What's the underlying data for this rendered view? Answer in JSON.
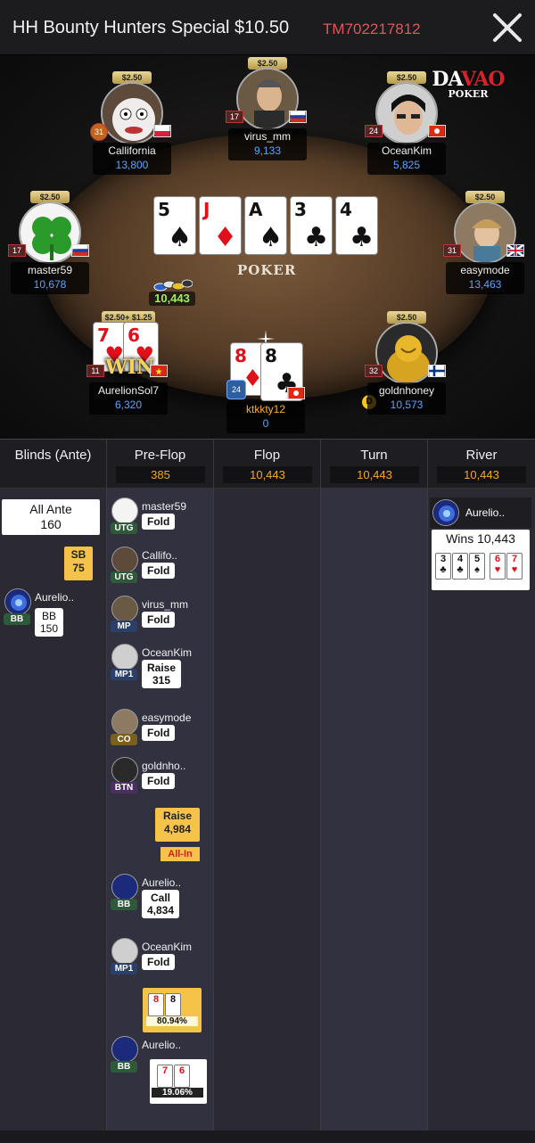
{
  "header": {
    "title": "HH Bounty Hunters Special $10.50",
    "hand_id": "TM702217812",
    "close_icon": "close-icon"
  },
  "logo": {
    "line1_a": "DA",
    "line1_b": "VAO",
    "line2": "POKER"
  },
  "table": {
    "watermark": "POKER",
    "pot": "10,443",
    "board": [
      {
        "rank": "5",
        "suit": "♠",
        "color": "black"
      },
      {
        "rank": "J",
        "suit": "♦",
        "color": "red"
      },
      {
        "rank": "A",
        "suit": "♠",
        "color": "black"
      },
      {
        "rank": "3",
        "suit": "♣",
        "color": "black"
      },
      {
        "rank": "4",
        "suit": "♣",
        "color": "black"
      }
    ],
    "seats": {
      "callifornia": {
        "name": "Callifornia",
        "stack": "13,800",
        "bet": "$2.50",
        "level": "31"
      },
      "virus": {
        "name": "virus_mm",
        "stack": "9,133",
        "bet": "$2.50",
        "level": "17"
      },
      "oceankim": {
        "name": "OceanKim",
        "stack": "5,825",
        "bet": "$2.50",
        "level": "24"
      },
      "master": {
        "name": "master59",
        "stack": "10,678",
        "bet": "$2.50",
        "level": "17"
      },
      "easymode": {
        "name": "easymode",
        "stack": "13,463",
        "bet": "$2.50",
        "level": "31"
      },
      "aurelion": {
        "name": "AurelionSol7",
        "stack": "6,320",
        "bet": "$2.50+ $1.25",
        "level": "11",
        "win": "WIN",
        "cards": [
          {
            "rank": "7",
            "suit": "♥"
          },
          {
            "rank": "6",
            "suit": "♥"
          }
        ]
      },
      "hero": {
        "name": "ktkkty12",
        "stack": "0",
        "level": "24",
        "cards": [
          {
            "rank": "8",
            "suit": "♦"
          },
          {
            "rank": "8",
            "suit": "♣"
          }
        ]
      },
      "goldnhoney": {
        "name": "goldnhoney",
        "stack": "10,573",
        "bet": "$2.50",
        "level": "32",
        "dealer": "D"
      }
    }
  },
  "streets": [
    {
      "name": "Blinds (Ante)",
      "amount": ""
    },
    {
      "name": "Pre-Flop",
      "amount": "385"
    },
    {
      "name": "Flop",
      "amount": "10,443"
    },
    {
      "name": "Turn",
      "amount": "10,443"
    },
    {
      "name": "River",
      "amount": "10,443"
    }
  ],
  "blinds": {
    "ante_label": "All Ante",
    "ante_value": "160",
    "sb_label": "SB",
    "sb_value": "75",
    "bb_player": "Aurelio..",
    "bb_pos": "BB",
    "bb_label": "BB",
    "bb_value": "150"
  },
  "preflop": [
    {
      "name": "master59",
      "pos": "UTG",
      "action": "Fold"
    },
    {
      "name": "Callifo..",
      "pos": "UTG",
      "action": "Fold"
    },
    {
      "name": "virus_mm",
      "pos": "MP",
      "action": "Fold"
    },
    {
      "name": "OceanKim",
      "pos": "MP1",
      "action": "Raise",
      "amount": "315"
    },
    {
      "name": "easymode",
      "pos": "CO",
      "action": "Fold"
    },
    {
      "name": "goldnho..",
      "pos": "BTN",
      "action": "Fold"
    },
    {
      "name": "Aurelio..",
      "pos": "BB",
      "action": "Call",
      "amount": "4,834"
    },
    {
      "name": "OceanKim",
      "pos": "MP1",
      "action": "Fold"
    },
    {
      "name": "Aurelio..",
      "pos": "BB"
    }
  ],
  "hero_raise": {
    "action": "Raise",
    "amount": "4,984",
    "allin": "All-In"
  },
  "hero_showdown": {
    "cards": [
      {
        "rank": "8",
        "suit": "♦"
      },
      {
        "rank": "8",
        "suit": "♣"
      }
    ],
    "equity": "80.94%"
  },
  "villain_showdown": {
    "cards": [
      {
        "rank": "7",
        "suit": "♥"
      },
      {
        "rank": "6",
        "suit": "♥"
      }
    ],
    "equity": "19.06%"
  },
  "river": {
    "player": "Aurelio..",
    "wins": "Wins 10,443",
    "cards": [
      {
        "rank": "3",
        "suit": "♣",
        "color": "black"
      },
      {
        "rank": "4",
        "suit": "♣",
        "color": "black"
      },
      {
        "rank": "5",
        "suit": "♠",
        "color": "black"
      },
      {
        "rank": "6",
        "suit": "♥",
        "color": "red"
      },
      {
        "rank": "7",
        "suit": "♥",
        "color": "red"
      }
    ]
  }
}
